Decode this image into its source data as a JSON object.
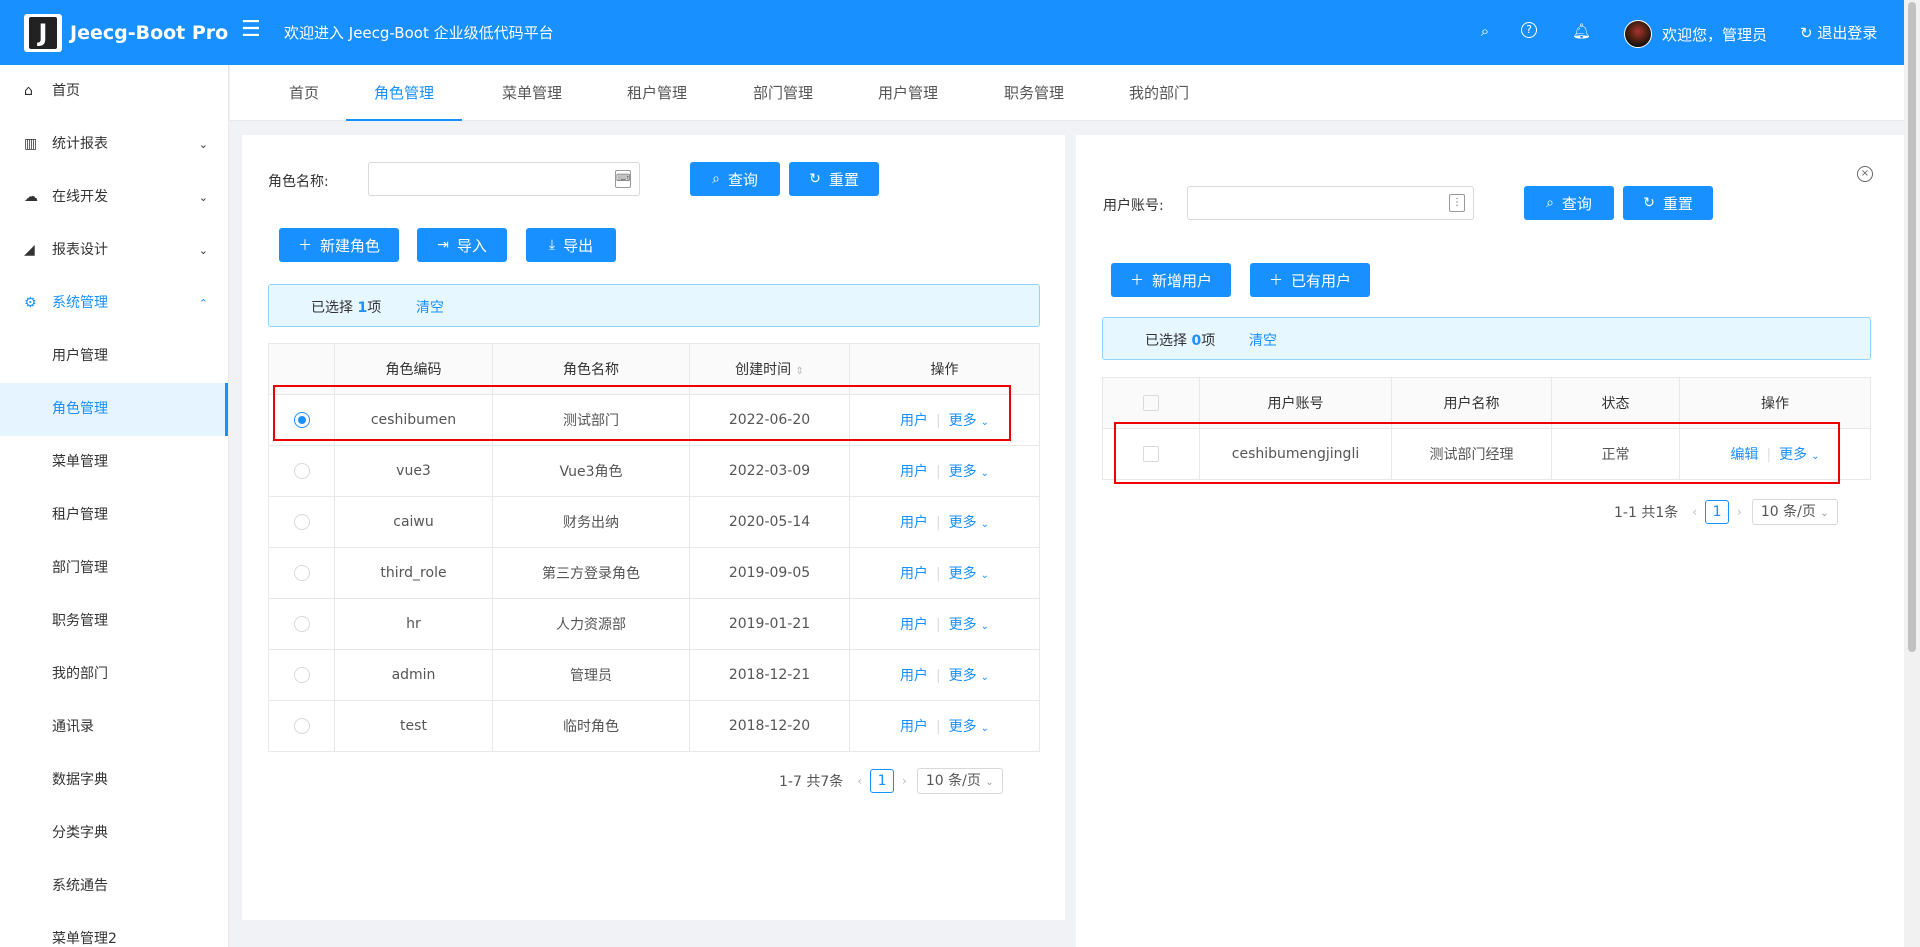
{
  "header": {
    "logo_letter": "J",
    "app_title": "Jeecg-Boot Pro",
    "welcome": "欢迎进入 Jeecg-Boot 企业级低代码平台",
    "greeting": "欢迎您，管理员",
    "logout": "退出登录",
    "color": "#1890ff"
  },
  "sidebar": {
    "items": [
      {
        "label": "首页",
        "icon": "home-icon"
      },
      {
        "label": "统计报表",
        "icon": "bar-chart-icon"
      },
      {
        "label": "在线开发",
        "icon": "cloud-icon"
      },
      {
        "label": "报表设计",
        "icon": "area-chart-icon"
      },
      {
        "label": "系统管理",
        "icon": "gear-icon"
      }
    ],
    "sub_items": [
      "用户管理",
      "角色管理",
      "菜单管理",
      "租户管理",
      "部门管理",
      "职务管理",
      "我的部门",
      "通讯录",
      "数据字典",
      "分类字典",
      "系统通告",
      "菜单管理2"
    ]
  },
  "tabs": [
    "首页",
    "角色管理",
    "菜单管理",
    "租户管理",
    "部门管理",
    "用户管理",
    "职务管理",
    "我的部门"
  ],
  "left": {
    "role_name_label": "角色名称:",
    "search": "查询",
    "reset": "重置",
    "new_role": "新建角色",
    "import": "导入",
    "export": "导出",
    "selected_prefix": "已选择",
    "selected_count": "1",
    "selected_suffix": "项",
    "clear": "清空",
    "columns": [
      "角色编码",
      "角色名称",
      "创建时间",
      "操作"
    ],
    "rows": [
      {
        "code": "ceshibumen",
        "name": "测试部门",
        "date": "2022-06-20"
      },
      {
        "code": "vue3",
        "name": "Vue3角色",
        "date": "2022-03-09"
      },
      {
        "code": "caiwu",
        "name": "财务出纳",
        "date": "2020-05-14"
      },
      {
        "code": "third_role",
        "name": "第三方登录角色",
        "date": "2019-09-05"
      },
      {
        "code": "hr",
        "name": "人力资源部",
        "date": "2019-01-21"
      },
      {
        "code": "admin",
        "name": "管理员",
        "date": "2018-12-21"
      },
      {
        "code": "test",
        "name": "临时角色",
        "date": "2018-12-20"
      }
    ],
    "action_user": "用户",
    "action_more": "更多",
    "pager_total": "1-7 共7条",
    "page": "1",
    "page_size": "10 条/页"
  },
  "right": {
    "account_label": "用户账号:",
    "search": "查询",
    "reset": "重置",
    "new_user": "新增用户",
    "existing_user": "已有用户",
    "selected_prefix": "已选择",
    "selected_count": "0",
    "selected_suffix": "项",
    "clear": "清空",
    "columns": [
      "用户账号",
      "用户名称",
      "状态",
      "操作"
    ],
    "row": {
      "account": "ceshibumengjingli",
      "name": "测试部门经理",
      "status": "正常"
    },
    "action_edit": "编辑",
    "action_more": "更多",
    "pager_total": "1-1 共1条",
    "page": "1",
    "page_size": "10 条/页"
  }
}
